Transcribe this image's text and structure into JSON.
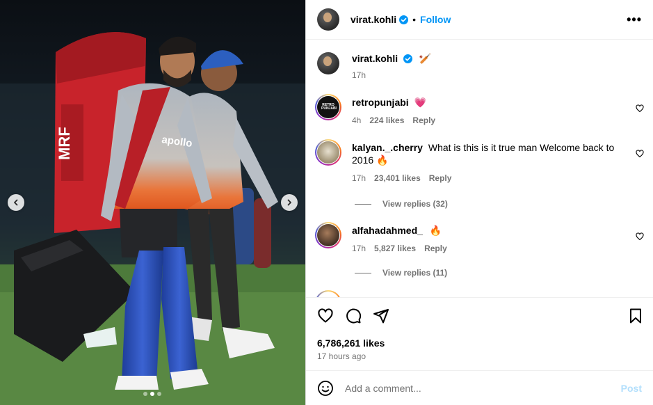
{
  "post": {
    "username": "virat.kohli",
    "follow_label": "Follow",
    "separator": "•",
    "more_icon": "more-horizontal-icon"
  },
  "caption": {
    "username": "virat.kohli",
    "emoji": "🏏",
    "time": "17h"
  },
  "comments": [
    {
      "username": "retropunjabi",
      "text": "💗",
      "time": "4h",
      "likes": "224 likes",
      "reply": "Reply",
      "avatar_text": "RETRO PUNJABI"
    },
    {
      "username": "kalyan._.cherry",
      "text": "What is this is it true man Welcome back to 2016 🔥",
      "time": "17h",
      "likes": "23,401 likes",
      "reply": "Reply",
      "view_replies": "View replies (32)"
    },
    {
      "username": "alfahadahmed_",
      "text": "🔥",
      "time": "17h",
      "likes": "5,827 likes",
      "reply": "Reply",
      "view_replies": "View replies (11)"
    }
  ],
  "actions": {
    "likes": "6,786,261 likes",
    "time_ago": "17 hours ago"
  },
  "add_comment": {
    "placeholder": "Add a comment...",
    "post_label": "Post"
  },
  "media": {
    "carousel_index": 2,
    "carousel_total": 3,
    "jersey_text": "apollo TYRES",
    "bag_brand": "MRF"
  },
  "colors": {
    "accent": "#0095f6",
    "post_disabled": "#b2dffc",
    "muted": "#737373"
  }
}
